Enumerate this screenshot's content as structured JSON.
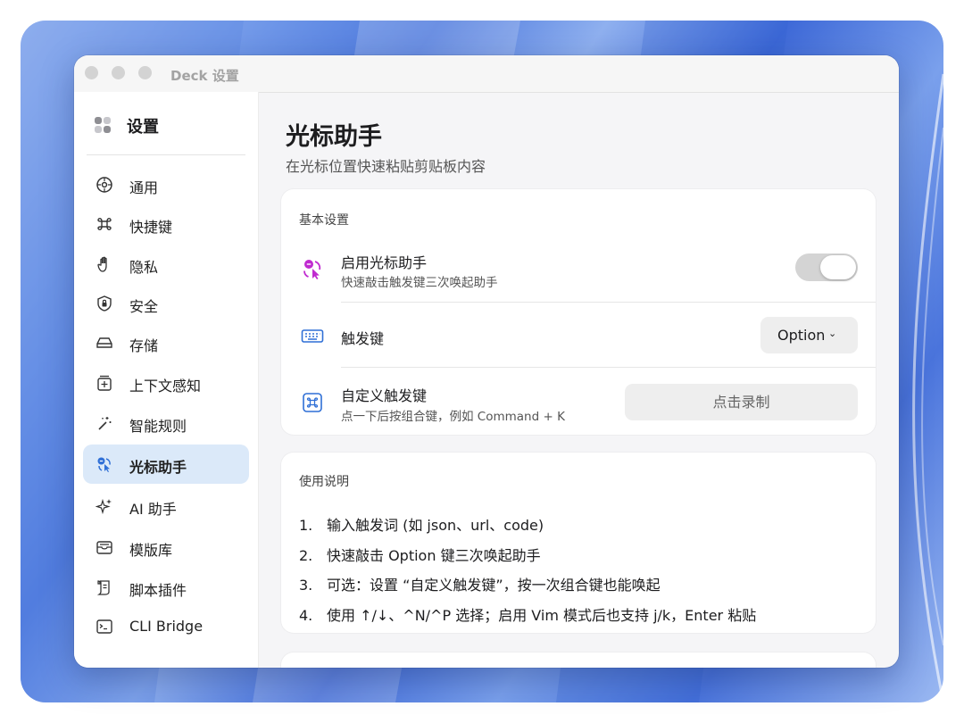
{
  "window": {
    "title": "Deck 设置"
  },
  "sidebar": {
    "header": "设置",
    "items": [
      {
        "label": "通用",
        "icon": "gear-icon"
      },
      {
        "label": "快捷键",
        "icon": "command-icon"
      },
      {
        "label": "隐私",
        "icon": "hand-icon"
      },
      {
        "label": "安全",
        "icon": "shield-lock-icon"
      },
      {
        "label": "存储",
        "icon": "drive-icon"
      },
      {
        "label": "上下文感知",
        "icon": "context-icon"
      },
      {
        "label": "智能规则",
        "icon": "magic-wand-icon"
      },
      {
        "label": "光标助手",
        "icon": "cursor-assistant-icon",
        "selected": true
      },
      {
        "label": "AI 助手",
        "icon": "sparkles-icon"
      },
      {
        "label": "模版库",
        "icon": "tray-icon"
      },
      {
        "label": "脚本插件",
        "icon": "script-icon"
      },
      {
        "label": "CLI Bridge",
        "icon": "terminal-icon"
      }
    ]
  },
  "page": {
    "title": "光标助手",
    "subtitle": "在光标位置快速粘贴剪贴板内容"
  },
  "basic": {
    "heading": "基本设置",
    "enable": {
      "title": "启用光标助手",
      "desc": "快速敲击触发键三次唤起助手",
      "on": true
    },
    "trigger": {
      "title": "触发键",
      "value": "Option",
      "chevron": "⌄"
    },
    "custom": {
      "title": "自定义触发键",
      "desc": "点一下后按组合键，例如 Command + K",
      "button": "点击录制"
    }
  },
  "usage": {
    "heading": "使用说明",
    "steps": [
      {
        "n": "1.",
        "text": "输入触发词 (如 json、url、code)"
      },
      {
        "n": "2.",
        "text": "快速敲击 Option 键三次唤起助手"
      },
      {
        "n": "3.",
        "text": "可选：设置 “自定义触发键”，按一次组合键也能唤起"
      },
      {
        "n": "4.",
        "text": "使用 ↑/↓、^N/^P 选择；启用 Vim 模式后也支持 j/k，Enter 粘贴"
      }
    ]
  },
  "colors": {
    "accent": "#2f6fd6",
    "magenta": "#c02ad0",
    "selected_bg": "#dbe9f9",
    "toggle_bg": "#d4d4d4"
  }
}
